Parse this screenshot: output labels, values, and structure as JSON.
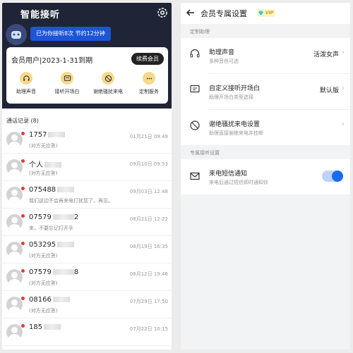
{
  "left": {
    "app_title": "智能接听",
    "quota_pill": "已为你接听8次 节约12分钟",
    "member": {
      "title": "会员用户|2023-1-31到期",
      "renew_label": "续费会员",
      "features": [
        {
          "label": "助理声音",
          "icon": "headset-icon"
        },
        {
          "label": "接听开场白",
          "icon": "chat-icon"
        },
        {
          "label": "谢绝骚扰来电",
          "icon": "block-icon"
        },
        {
          "label": "定制服务",
          "icon": "more-icon"
        }
      ]
    },
    "records_header": "通话记录 (8)",
    "records": [
      {
        "number": "1757",
        "sub": "(对方无应答)",
        "time": "01月21日 09:49"
      },
      {
        "number": "个人",
        "sub": "(对方无应答)",
        "time": "09月10日 09:53"
      },
      {
        "number": "075488",
        "sub": "我们这边不会再来电打扰您了，再见。",
        "time": "09月03日 12:48"
      },
      {
        "number": "07579",
        "number_tail": "2",
        "sub": "来，不要忘记打开手",
        "time": "08月21日 12:22"
      },
      {
        "number": "053295",
        "sub": "(对方无应答)",
        "time": "08月19日 16:35"
      },
      {
        "number": "07579",
        "number_tail": "8",
        "sub": "(对方无应答)",
        "time": "08月12日 19:46"
      },
      {
        "number": "08166",
        "sub": "(对方无应答)",
        "time": "07月29日 17:50"
      },
      {
        "number": "185",
        "sub": "",
        "time": "07月22日 10:15"
      }
    ]
  },
  "right": {
    "title": "会员专属设置",
    "vip_badge": "VIP",
    "section1": "定制助理",
    "items": [
      {
        "title": "助理声音",
        "desc": "多种音色可选",
        "value": "活泼女声",
        "icon": "headset-icon"
      },
      {
        "title": "自定义接听开场白",
        "desc": "助理开场白类型选择",
        "value": "默认版",
        "icon": "chat-icon"
      },
      {
        "title": "谢绝骚扰来电设置",
        "desc": "助理直接谢绝来电并挂断",
        "value": "",
        "icon": "block-icon"
      }
    ],
    "section2": "专属接听设置",
    "sms": {
      "title": "来电短信通知",
      "desc": "来电后通过短信即时通知你",
      "enabled": true
    },
    "colors": {
      "accent": "#1a6bf0",
      "dark": "#1f2536",
      "gold": "#f6d98b"
    }
  }
}
